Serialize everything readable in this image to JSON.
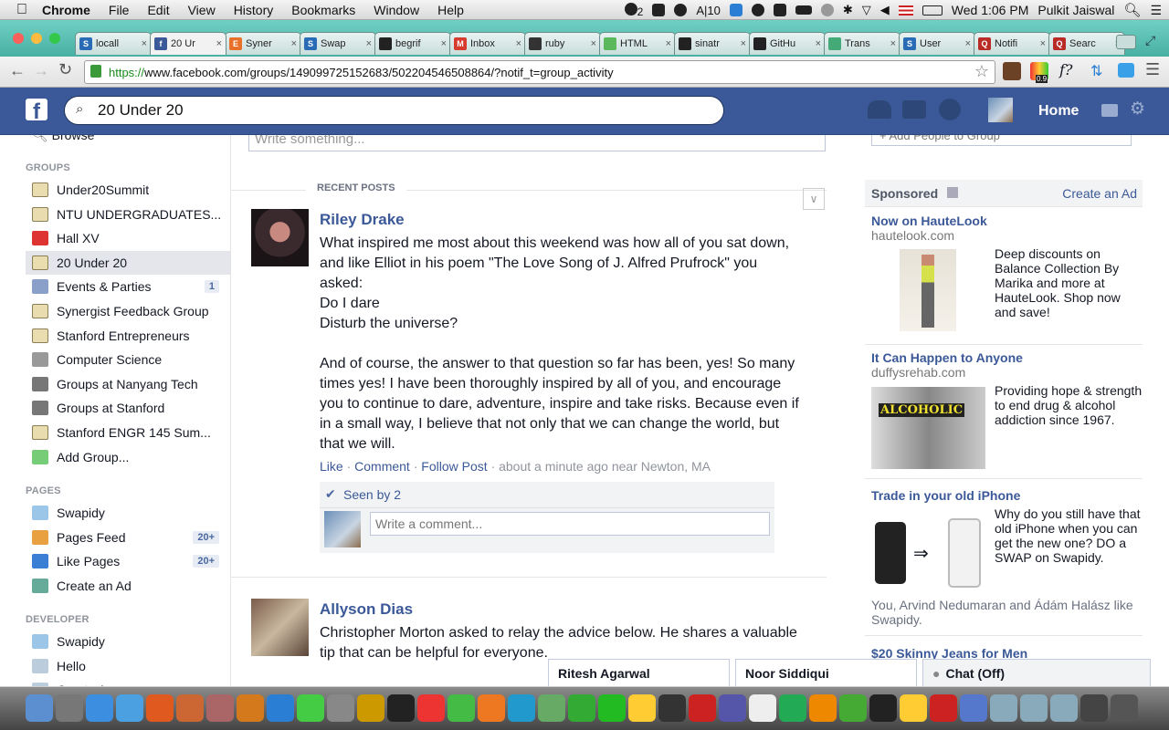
{
  "menubar": {
    "apple": "",
    "app": "Chrome",
    "items": [
      "File",
      "Edit",
      "View",
      "History",
      "Bookmarks",
      "Window",
      "Help"
    ],
    "badge_count": "2",
    "a_count": "10",
    "clock": "Wed 1:06 PM",
    "user": "Pulkit Jaiswal"
  },
  "tabs": [
    {
      "label": "locall",
      "color": "#2a6bb5",
      "glyph": "S"
    },
    {
      "label": "20 Ur",
      "color": "#3b5998",
      "glyph": "f"
    },
    {
      "label": "Syner",
      "color": "#e8702a",
      "glyph": "E"
    },
    {
      "label": "Swap",
      "color": "#2a6bb5",
      "glyph": "S"
    },
    {
      "label": "begrif",
      "color": "#222222",
      "glyph": ""
    },
    {
      "label": "Inbox",
      "color": "#d73b2f",
      "glyph": "M"
    },
    {
      "label": "ruby",
      "color": "#333333",
      "glyph": ""
    },
    {
      "label": "HTML",
      "color": "#5cb85c",
      "glyph": ""
    },
    {
      "label": "sinatr",
      "color": "#222222",
      "glyph": ""
    },
    {
      "label": "GitHu",
      "color": "#222222",
      "glyph": ""
    },
    {
      "label": "Trans",
      "color": "#4a7",
      "glyph": ""
    },
    {
      "label": "User",
      "color": "#2a6bb5",
      "glyph": "S"
    },
    {
      "label": "Notifi",
      "color": "#b92b27",
      "glyph": "Q"
    },
    {
      "label": "Searc",
      "color": "#b92b27",
      "glyph": "Q"
    }
  ],
  "toolbar": {
    "url_scheme": "https://",
    "url_rest": "www.facebook.com/groups/149099725152683/502204546508864/?notif_t=group_activity",
    "ext_badge": "0.9",
    "ext_f": "f?"
  },
  "fb": {
    "search_value": "20 Under 20",
    "home": "Home"
  },
  "left": {
    "browse": "Browse",
    "groups_header": "GROUPS",
    "groups": [
      {
        "label": "Under20Summit"
      },
      {
        "label": "NTU UNDERGRADUATES..."
      },
      {
        "label": "Hall XV"
      },
      {
        "label": "20 Under 20"
      },
      {
        "label": "Events & Parties",
        "count": "1"
      },
      {
        "label": "Synergist Feedback Group"
      },
      {
        "label": "Stanford Entrepreneurs"
      },
      {
        "label": "Computer Science"
      },
      {
        "label": "Groups at Nanyang Tech"
      },
      {
        "label": "Groups at Stanford"
      },
      {
        "label": "Stanford ENGR 145 Sum..."
      },
      {
        "label": "Add Group..."
      }
    ],
    "pages_header": "PAGES",
    "pages": [
      {
        "label": "Swapidy"
      },
      {
        "label": "Pages Feed",
        "count": "20+"
      },
      {
        "label": "Like Pages",
        "count": "20+"
      },
      {
        "label": "Create an Ad"
      }
    ],
    "developer_header": "DEVELOPER",
    "developer": [
      {
        "label": "Swapidy"
      },
      {
        "label": "Hello"
      },
      {
        "label": "Create App"
      }
    ]
  },
  "main": {
    "composer_placeholder": "Write something...",
    "recent_posts": "RECENT POSTS",
    "post1": {
      "author": "Riley Drake",
      "text": "What inspired me most about this weekend was how all of you sat down, and like Elliot in his poem \"The Love Song of J. Alfred Prufrock\" you asked:\nDo I dare\nDisturb the universe?\n\nAnd of course, the answer to that question so far has been, yes! So many times yes! I have been thoroughly inspired by all of you, and encourage you to continue to dare, adventure, inspire and take risks. Because even if in a small way, I believe that not only that we can change the world, but that we will.",
      "like": "Like",
      "comment": "Comment",
      "follow": "Follow Post",
      "time": "about a minute ago near Newton, MA",
      "seen": "Seen by 2",
      "comment_placeholder": "Write a comment..."
    },
    "post2": {
      "author": "Allyson Dias",
      "text": "Christopher Morton asked to relay the advice below. He shares a valuable tip that can be helpful for everyone."
    }
  },
  "right": {
    "add_people": "+ Add People to Group",
    "sponsored": "Sponsored",
    "create_ad": "Create an Ad",
    "ads": [
      {
        "title": "Now on HauteLook",
        "domain": "hautelook.com",
        "body": "Deep discounts on Balance Collection By Marika and more at HauteLook. Shop now and save!"
      },
      {
        "title": "It Can Happen to Anyone",
        "domain": "duffysrehab.com",
        "body": "Providing hope & strength to end drug & alcohol addiction since 1967.",
        "image_text": "ALCOHOLIC"
      },
      {
        "title": "Trade in your old iPhone",
        "body": "Why do you still have that old iPhone when you can get the new one? DO a SWAP on Swapidy.",
        "social": "You, Arvind Nedumaran and Ádám Halász like Swapidy."
      },
      {
        "title": "$20 Skinny Jeans for Men"
      }
    ]
  },
  "chat": {
    "tab1": "Ritesh Agarwal",
    "tab2": "Noor Siddiqui",
    "status": "Chat (Off)"
  },
  "dock_colors": [
    "#5b8fd0",
    "#777",
    "#3b8ee0",
    "#4aa0e0",
    "#e05a20",
    "#c63",
    "#a66",
    "#d47a1c",
    "#2a7fd4",
    "#4c4",
    "#888",
    "#c90",
    "#222",
    "#e33",
    "#4b4",
    "#e72",
    "#29c",
    "#6a6",
    "#3a3",
    "#2b2",
    "#fc3",
    "#333",
    "#c22",
    "#55a",
    "#eee",
    "#2a5",
    "#e80",
    "#4a3",
    "#222",
    "#fc3",
    "#c22",
    "#57c",
    "#8ab",
    "#8ab",
    "#8ab",
    "#444",
    "#555"
  ]
}
